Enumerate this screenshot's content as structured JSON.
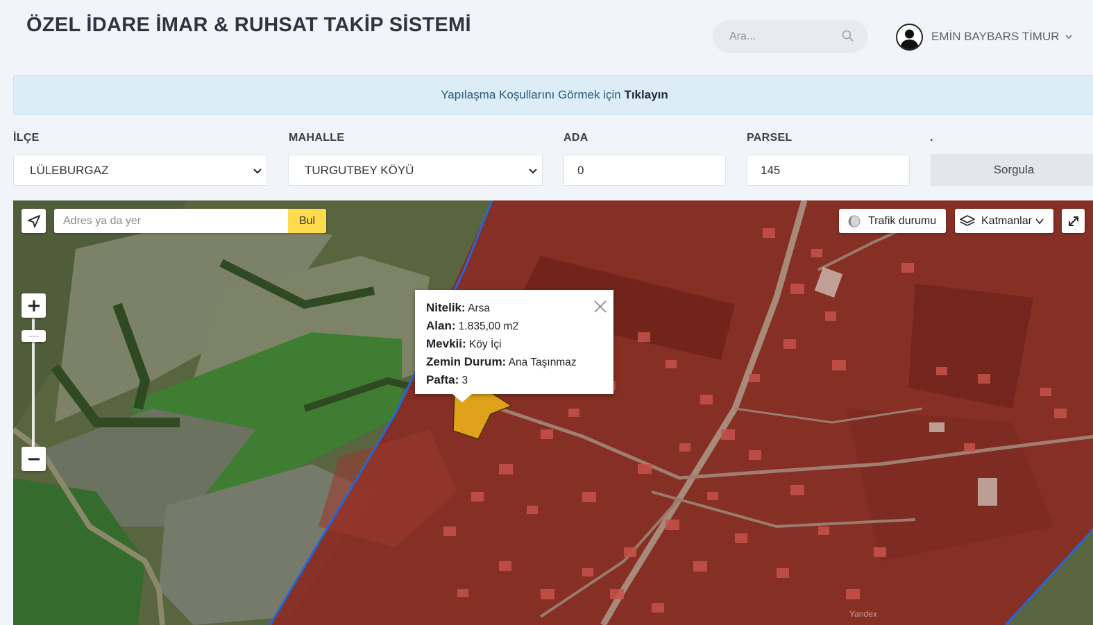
{
  "header": {
    "title": "ÖZEL İDARE İMAR & RUHSAT TAKİP SİSTEMİ",
    "search_placeholder": "Ara...",
    "user_name": "EMİN BAYBARS TİMUR"
  },
  "banner": {
    "text": "Yapılaşma Koşullarını Görmek için ",
    "link": "Tıklayın"
  },
  "form": {
    "ilce_label": "İLÇE",
    "ilce_value": "LÜLEBURGAZ",
    "mahalle_label": "MAHALLE",
    "mahalle_value": "TURGUTBEY KÖYÜ",
    "ada_label": "ADA",
    "ada_value": "0",
    "parsel_label": "PARSEL",
    "parsel_value": "145",
    "dot_label": ".",
    "submit_label": "Sorgula"
  },
  "map": {
    "search_placeholder": "Adres ya da yer",
    "find_label": "Bul",
    "traffic_label": "Trafik durumu",
    "layers_label": "Katmanlar",
    "watermark": "Yandex",
    "popup": {
      "nitelik_label": "Nitelik:",
      "nitelik_value": " Arsa",
      "alan_label": "Alan:",
      "alan_value": " 1.835,00 m2",
      "mevkii_label": "Mevkii:",
      "mevkii_value": " Köy İçi",
      "zemin_label": "Zemin Durum:",
      "zemin_value": " Ana Taşınmaz",
      "pafta_label": "Pafta:",
      "pafta_value": " 3"
    }
  },
  "colors": {
    "zone_overlay": "#8a2a22",
    "parcel_fill": "#e0a21a",
    "boundary_line": "#2266dd",
    "find_button": "#ffdb4d"
  },
  "icons": [
    "search-icon",
    "avatar-icon",
    "chevron-down-icon",
    "locate-arrow-icon",
    "traffic-icon",
    "layers-icon",
    "fullscreen-icon",
    "zoom-in-icon",
    "zoom-out-icon",
    "close-icon"
  ]
}
